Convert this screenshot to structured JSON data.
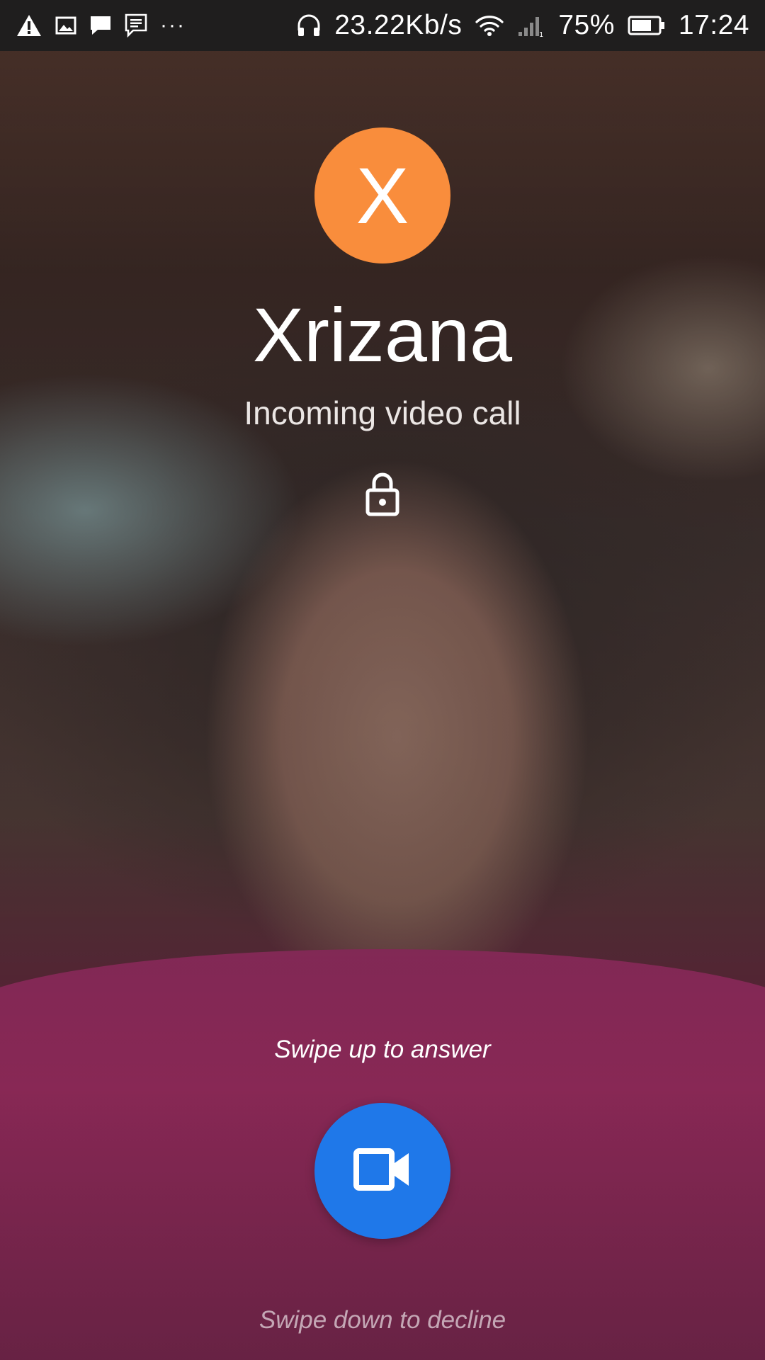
{
  "status_bar": {
    "left_icons": [
      "warning-icon",
      "image-icon",
      "message-icon",
      "chat-icon"
    ],
    "overflow": "···",
    "headset_icon": "headset-icon",
    "network_speed": "23.22Kb/s",
    "wifi_icon": "wifi-icon",
    "signal_icon": "signal-icon",
    "battery_percent": "75%",
    "battery_level": 0.75,
    "battery_icon": "battery-icon",
    "time": "17:24"
  },
  "call": {
    "avatar_letter": "X",
    "avatar_color": "#f98d3c",
    "caller_name": "Xrizana",
    "status": "Incoming video call",
    "lock_icon": "lock-icon",
    "swipe_up_hint": "Swipe up to answer",
    "answer_icon": "video-camera-icon",
    "answer_color": "#1f78e9",
    "swipe_down_hint": "Swipe down to decline"
  }
}
